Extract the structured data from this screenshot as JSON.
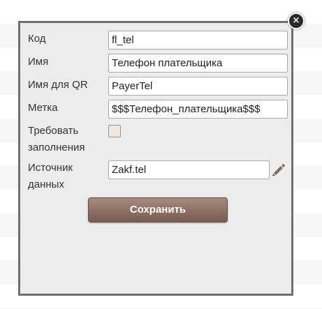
{
  "dialog": {
    "close_icon": "×",
    "fields": {
      "code": {
        "label": "Код",
        "value": "fl_tel"
      },
      "name": {
        "label": "Имя",
        "value": "Телефон плательщика"
      },
      "qr_name": {
        "label": "Имя для QR",
        "value": "PayerTel"
      },
      "mark": {
        "label": "Метка",
        "value": "$$$Телефон_плательщика$$$"
      },
      "required": {
        "label_line1": "Требовать",
        "label_line2": "заполнения",
        "checked": false
      },
      "source": {
        "label_line1": "Источник",
        "label_line2": "данных",
        "value": "Zakf.tel",
        "edit_icon": "pencil-icon"
      }
    },
    "save_label": "Сохранить"
  },
  "colors": {
    "dialog_bg": "#ececec",
    "dialog_border": "#707070",
    "button_bg": "#8c6e63",
    "checkbox_bg": "#f1e6dd"
  }
}
